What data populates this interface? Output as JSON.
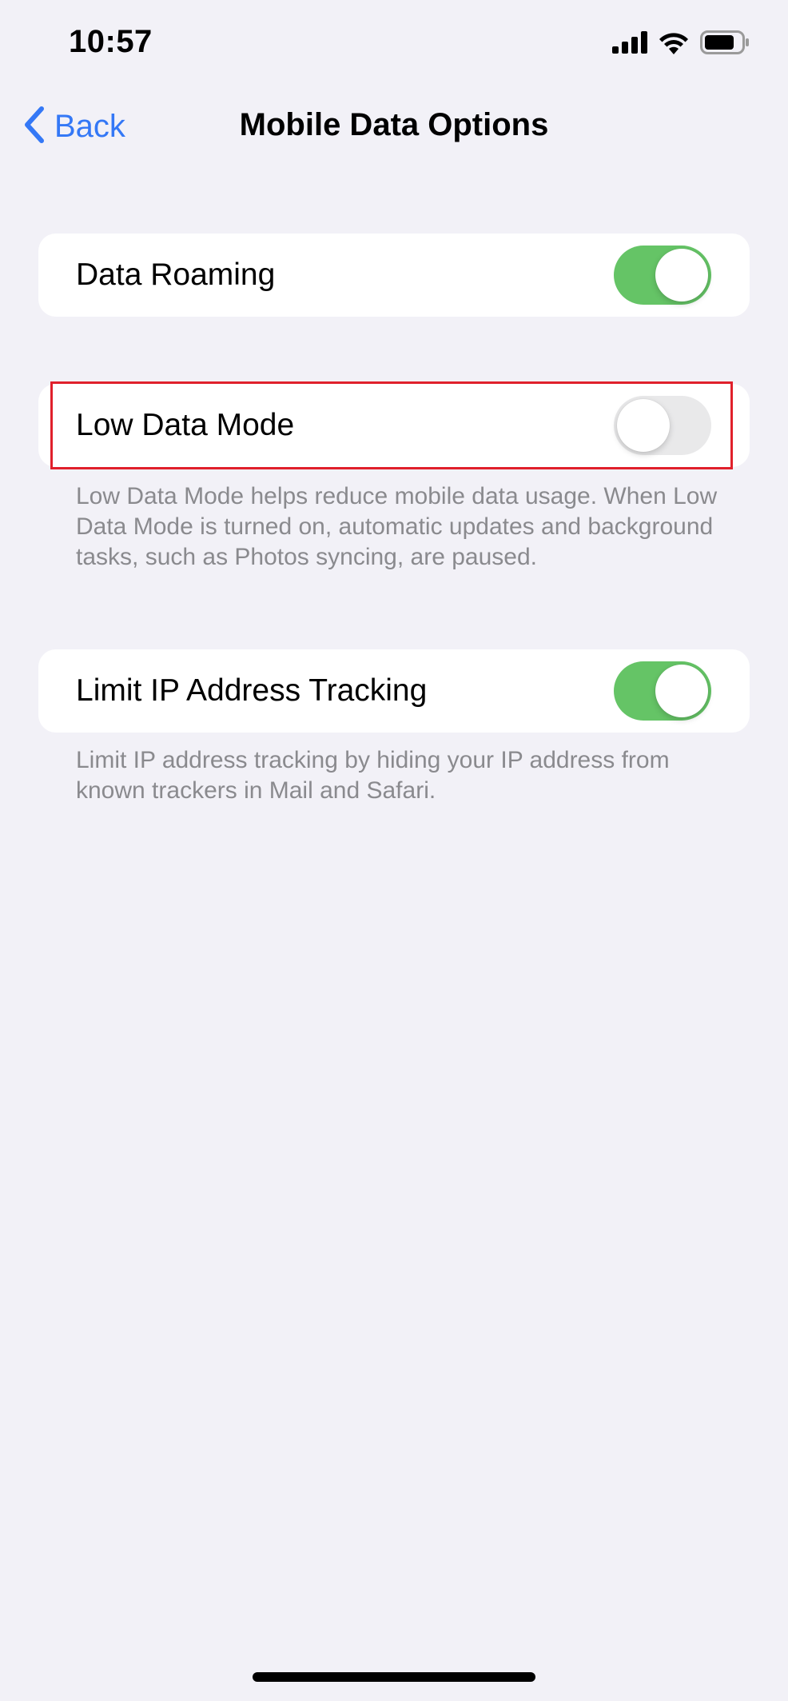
{
  "status_bar": {
    "time": "10:57",
    "icons": [
      "cellular-signal-icon",
      "wifi-icon",
      "battery-icon"
    ]
  },
  "nav": {
    "back_label": "Back",
    "title": "Mobile Data Options"
  },
  "settings": [
    {
      "label": "Data Roaming",
      "toggle": "on"
    },
    {
      "label": "Low Data Mode",
      "toggle": "off",
      "footer": "Low Data Mode helps reduce mobile data usage. When Low Data Mode is turned on, automatic updates and background tasks, such as Photos syncing, are paused."
    },
    {
      "label": "Limit IP Address Tracking",
      "toggle": "on",
      "footer": "Limit IP address tracking by hiding your IP address from known trackers in Mail and Safari."
    }
  ],
  "colors": {
    "accent": "#3478f6",
    "toggle_on": "#65c466",
    "toggle_off": "#e9e9ea",
    "background": "#f2f1f7",
    "highlight": "#e0202b"
  }
}
